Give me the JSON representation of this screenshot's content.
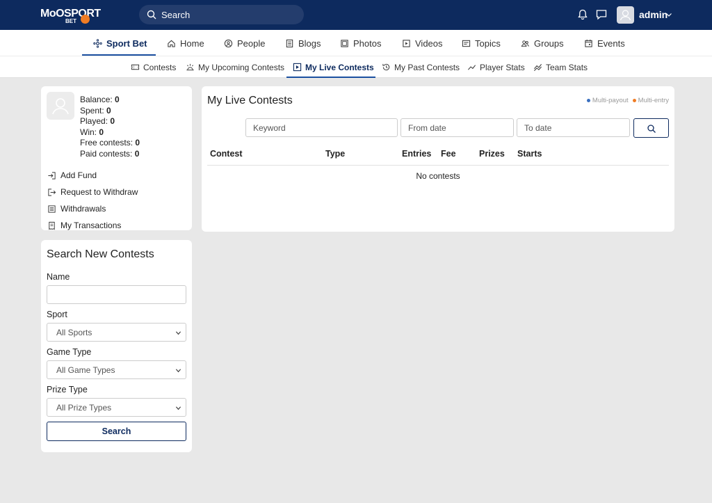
{
  "app": {
    "logo_main": "MoOSPORT",
    "logo_sub": "BET",
    "search_placeholder": "Search",
    "user_name": "admin"
  },
  "main_nav": [
    {
      "label": "Sport Bet",
      "icon": "sport-bet-icon",
      "active": true
    },
    {
      "label": "Home",
      "icon": "home-icon"
    },
    {
      "label": "People",
      "icon": "people-icon"
    },
    {
      "label": "Blogs",
      "icon": "blogs-icon"
    },
    {
      "label": "Photos",
      "icon": "photos-icon"
    },
    {
      "label": "Videos",
      "icon": "videos-icon"
    },
    {
      "label": "Topics",
      "icon": "topics-icon"
    },
    {
      "label": "Groups",
      "icon": "groups-icon"
    },
    {
      "label": "Events",
      "icon": "events-icon"
    }
  ],
  "sub_nav": [
    {
      "label": "Contests",
      "icon": "ticket-icon"
    },
    {
      "label": "My Upcoming Contests",
      "icon": "upcoming-icon"
    },
    {
      "label": "My Live Contests",
      "icon": "play-icon",
      "active": true
    },
    {
      "label": "My Past Contests",
      "icon": "history-icon"
    },
    {
      "label": "Player Stats",
      "icon": "chart-line-icon"
    },
    {
      "label": "Team Stats",
      "icon": "chart-lines-icon"
    }
  ],
  "account": {
    "balance_label": "Balance:",
    "balance": "0",
    "spent_label": "Spent:",
    "spent": "0",
    "played_label": "Played:",
    "played": "0",
    "win_label": "Win:",
    "win": "0",
    "free_label": "Free contests:",
    "free": "0",
    "paid_label": "Paid contests:",
    "paid": "0",
    "links": [
      "Add Fund",
      "Request to Withdraw",
      "Withdrawals",
      "My Transactions"
    ]
  },
  "search_card": {
    "title": "Search New Contests",
    "name_label": "Name",
    "sport_label": "Sport",
    "sport_value": "All Sports",
    "game_type_label": "Game Type",
    "game_type_value": "All Game Types",
    "prize_type_label": "Prize Type",
    "prize_type_value": "All Prize Types",
    "button": "Search"
  },
  "live": {
    "title": "My Live Contests",
    "legend_multi_payout": "Multi-payout",
    "legend_multi_entry": "Multi-entry",
    "keyword_placeholder": "Keyword",
    "from_placeholder": "From date",
    "to_placeholder": "To date",
    "columns": [
      "Contest",
      "Type",
      "Entries",
      "Fee",
      "Prizes",
      "Starts"
    ],
    "empty": "No contests"
  },
  "colors": {
    "header_bg": "#0d2a5e",
    "accent": "#1a4fa0",
    "multi_payout": "#3a6fbf",
    "multi_entry": "#f07c24"
  }
}
